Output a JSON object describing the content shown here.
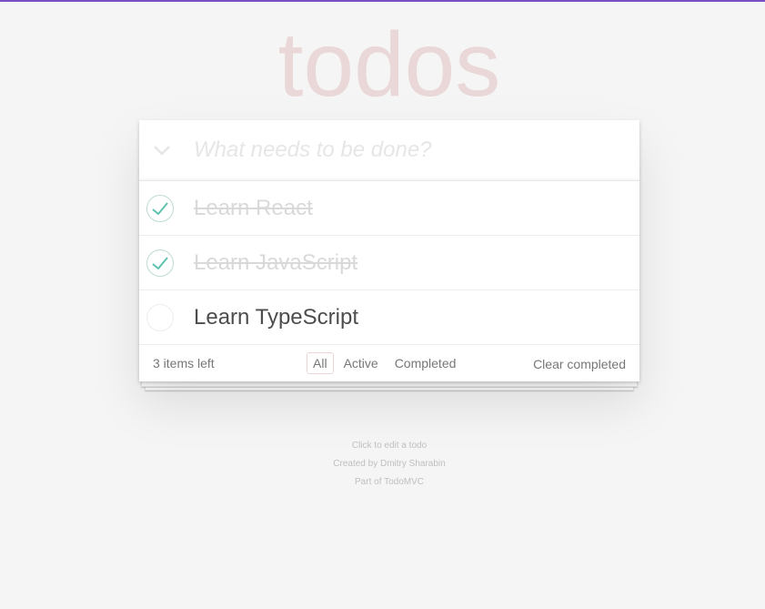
{
  "app": {
    "title": "todos",
    "accent_color": "#7b4fc4",
    "title_color": "#af2f2f"
  },
  "header": {
    "new_todo_placeholder": "What needs to be done?",
    "new_todo_value": "",
    "toggle_all_icon": "chevron-down-icon"
  },
  "todos": [
    {
      "label": "Learn React",
      "completed": true
    },
    {
      "label": "Learn JavaScript",
      "completed": true
    },
    {
      "label": "Learn TypeScript",
      "completed": false
    }
  ],
  "footer": {
    "count_text": "3 items left",
    "filters": {
      "all": "All",
      "active": "Active",
      "completed": "Completed"
    },
    "selected_filter": "all",
    "clear_completed": "Clear completed"
  },
  "info": {
    "line1": "Click to edit a todo",
    "line2_prefix": "Created by ",
    "line2_author": "Dmitry Sharabin",
    "line3_prefix": "Part of ",
    "line3_link": "TodoMVC"
  }
}
